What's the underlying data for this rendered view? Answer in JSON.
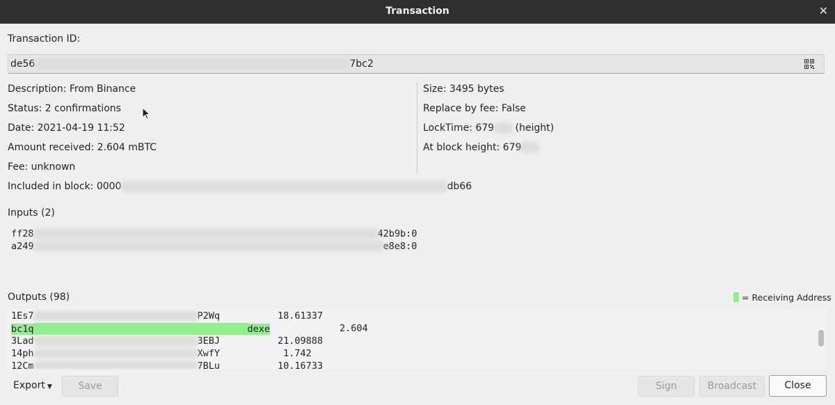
{
  "window": {
    "title": "Transaction"
  },
  "txid": {
    "label": "Transaction ID:",
    "prefix": "de56",
    "suffix": "7bc2"
  },
  "details_left": {
    "description": "Description: From Binance",
    "status": "Status: 2 confirmations",
    "date": "Date: 2021-04-19 11:52",
    "amount": "Amount received: 2.604 mBTC",
    "fee": "Fee: unknown"
  },
  "details_right": {
    "size": "Size: 3495 bytes",
    "rbf": "Replace by fee: False",
    "locktime_prefix": "LockTime: 679",
    "locktime_suffix": "(height)",
    "block_height_prefix": "At block height: 679"
  },
  "included": {
    "prefix": "Included in block: 0000",
    "suffix": "db66"
  },
  "inputs": {
    "label": "Inputs (2)",
    "items": [
      {
        "prefix": "ff28",
        "suffix": "42b9b:0"
      },
      {
        "prefix": "a249",
        "suffix": "e8e8:0"
      }
    ]
  },
  "outputs": {
    "label": "Outputs (98)",
    "legend": "= Receiving Address",
    "items": [
      {
        "prefix": "1Es7",
        "suffix": "P2Wq",
        "amount": "18.61337"
      },
      {
        "prefix": "bc1q",
        "suffix": "dexe",
        "amount": "2.604"
      },
      {
        "prefix": "3Lad",
        "suffix": "3EBJ",
        "amount": "21.09888"
      },
      {
        "prefix": "14ph",
        "suffix": "XwfY",
        "amount": "1.742"
      },
      {
        "prefix": "12Cm",
        "suffix": "7BLu",
        "amount": "10.16733"
      }
    ]
  },
  "buttons": {
    "export": "Export",
    "save": "Save",
    "sign": "Sign",
    "broadcast": "Broadcast",
    "close": "Close"
  },
  "colors": {
    "receiving_highlight": "#90ee90",
    "titlebar": "#2f2f2f"
  }
}
